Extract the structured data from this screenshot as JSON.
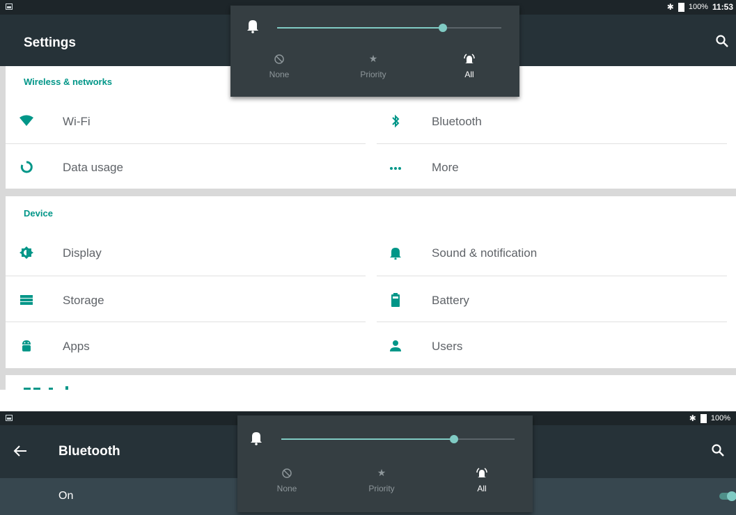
{
  "screen1": {
    "status": {
      "battery": "100%",
      "time": "11:53"
    },
    "toolbar": {
      "title": "Settings"
    },
    "sections": [
      {
        "header": "Wireless & networks",
        "items": [
          {
            "label": "Wi-Fi",
            "icon": "wifi-icon"
          },
          {
            "label": "Bluetooth",
            "icon": "bluetooth-icon"
          },
          {
            "label": "Data usage",
            "icon": "data-usage-icon"
          },
          {
            "label": "More",
            "icon": "more-icon"
          }
        ]
      },
      {
        "header": "Device",
        "items": [
          {
            "label": "Display",
            "icon": "display-icon"
          },
          {
            "label": "Sound & notification",
            "icon": "bell-icon"
          },
          {
            "label": "Storage",
            "icon": "storage-icon"
          },
          {
            "label": "Battery",
            "icon": "battery-icon"
          },
          {
            "label": "Apps",
            "icon": "android-icon"
          },
          {
            "label": "Users",
            "icon": "person-icon"
          }
        ]
      }
    ],
    "volume_panel": {
      "level": 0.74,
      "modes": [
        {
          "label": "None",
          "icon": "none-icon"
        },
        {
          "label": "Priority",
          "icon": "star-icon"
        },
        {
          "label": "All",
          "icon": "bell-all-icon",
          "active": true
        }
      ]
    }
  },
  "screen2": {
    "status": {
      "battery": "100%"
    },
    "toolbar": {
      "title": "Bluetooth"
    },
    "switch_row": {
      "label": "On"
    },
    "volume_panel": {
      "level": 0.74,
      "modes": [
        {
          "label": "None",
          "icon": "none-icon"
        },
        {
          "label": "Priority",
          "icon": "star-icon"
        },
        {
          "label": "All",
          "icon": "bell-all-icon",
          "active": true
        }
      ]
    }
  },
  "colors": {
    "accent": "#009688",
    "toolbar": "#263238",
    "panel": "#353e42",
    "slider": "#80cbc4"
  }
}
